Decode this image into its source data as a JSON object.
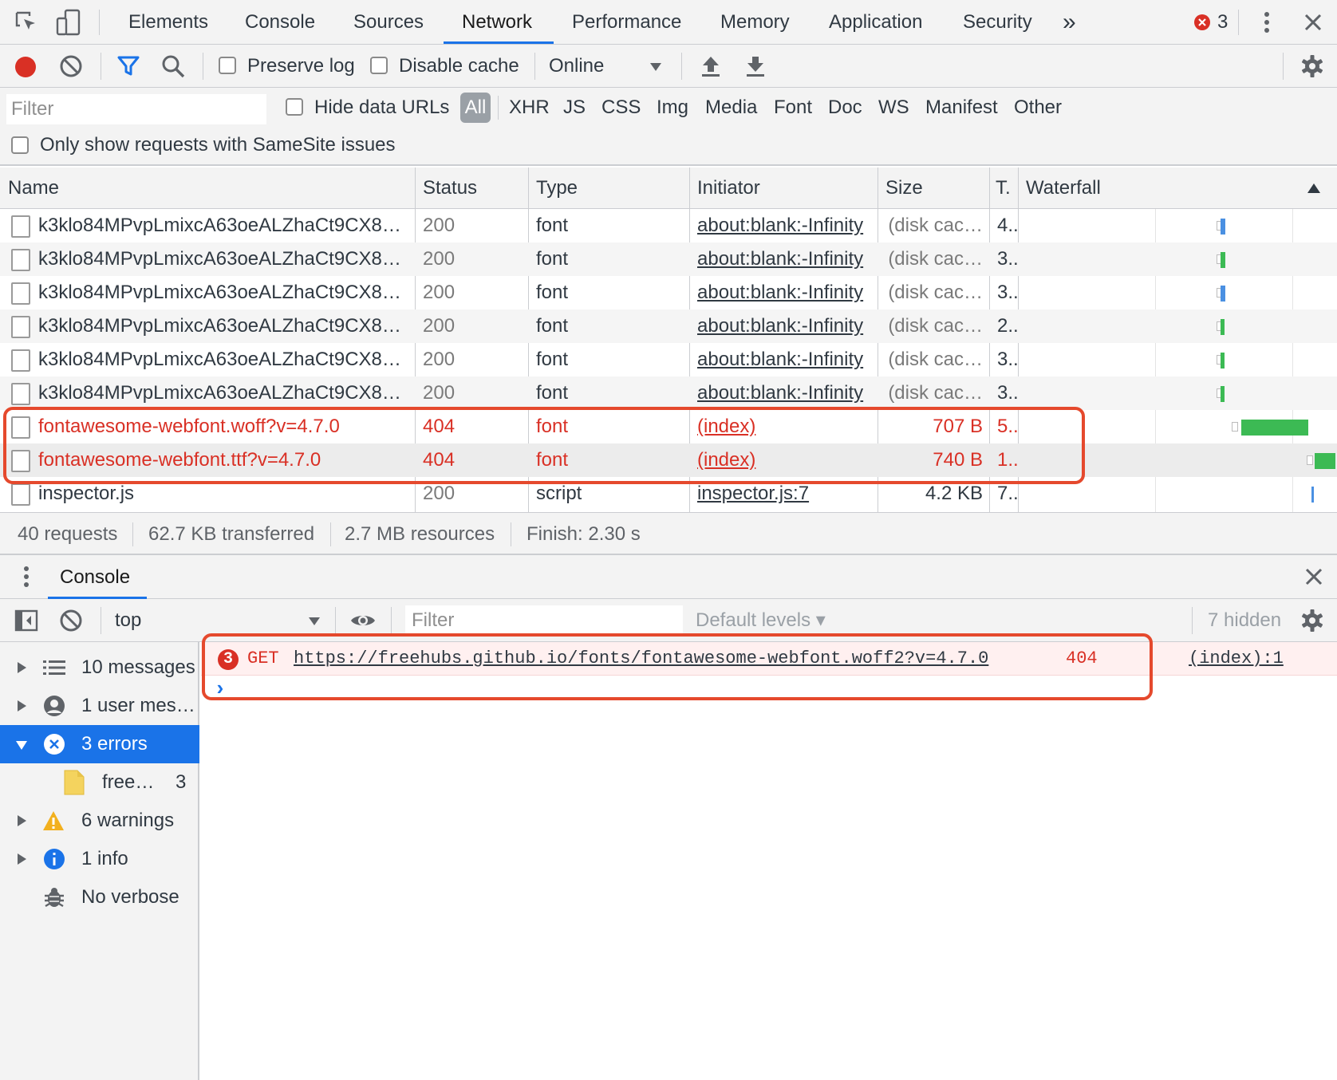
{
  "tabbar": {
    "tabs": [
      "Elements",
      "Console",
      "Sources",
      "Network",
      "Performance",
      "Memory",
      "Application",
      "Security"
    ],
    "active_tab": "Network",
    "more_label": "»",
    "error_count": "3"
  },
  "toolbar": {
    "preserve_log": "Preserve log",
    "disable_cache": "Disable cache",
    "throttling": "Online"
  },
  "filterbar": {
    "filter_placeholder": "Filter",
    "hide_data_urls": "Hide data URLs",
    "types": [
      "All",
      "XHR",
      "JS",
      "CSS",
      "Img",
      "Media",
      "Font",
      "Doc",
      "WS",
      "Manifest",
      "Other"
    ],
    "active_type": "All",
    "samesite": "Only show requests with SameSite issues"
  },
  "table": {
    "columns": {
      "name": "Name",
      "status": "Status",
      "type": "Type",
      "initiator": "Initiator",
      "size": "Size",
      "time": "T.",
      "waterfall": "Waterfall"
    },
    "rows": [
      {
        "name": "k3klo84MPvpLmixcA63oeALZhaCt9CX8…",
        "status": "200",
        "type": "font",
        "initiator": "about:blank:-Infinity",
        "size": "(disk cac…",
        "time": "4..",
        "error": false
      },
      {
        "name": "k3klo84MPvpLmixcA63oeALZhaCt9CX8…",
        "status": "200",
        "type": "font",
        "initiator": "about:blank:-Infinity",
        "size": "(disk cac…",
        "time": "3..",
        "error": false
      },
      {
        "name": "k3klo84MPvpLmixcA63oeALZhaCt9CX8…",
        "status": "200",
        "type": "font",
        "initiator": "about:blank:-Infinity",
        "size": "(disk cac…",
        "time": "3..",
        "error": false
      },
      {
        "name": "k3klo84MPvpLmixcA63oeALZhaCt9CX8…",
        "status": "200",
        "type": "font",
        "initiator": "about:blank:-Infinity",
        "size": "(disk cac…",
        "time": "2..",
        "error": false
      },
      {
        "name": "k3klo84MPvpLmixcA63oeALZhaCt9CX8…",
        "status": "200",
        "type": "font",
        "initiator": "about:blank:-Infinity",
        "size": "(disk cac…",
        "time": "3..",
        "error": false
      },
      {
        "name": "k3klo84MPvpLmixcA63oeALZhaCt9CX8…",
        "status": "200",
        "type": "font",
        "initiator": "about:blank:-Infinity",
        "size": "(disk cac…",
        "time": "3..",
        "error": false
      },
      {
        "name": "fontawesome-webfont.woff?v=4.7.0",
        "status": "404",
        "type": "font",
        "initiator": "(index)",
        "size": "707 B",
        "time": "5..",
        "error": true
      },
      {
        "name": "fontawesome-webfont.ttf?v=4.7.0",
        "status": "404",
        "type": "font",
        "initiator": "(index)",
        "size": "740 B",
        "time": "1..",
        "error": true
      },
      {
        "name": "inspector.js",
        "status": "200",
        "type": "script",
        "initiator": "inspector.js:7",
        "size": "4.2 KB",
        "time": "7..",
        "error": false
      }
    ]
  },
  "summary": {
    "requests": "40 requests",
    "transferred": "62.7 KB transferred",
    "resources": "2.7 MB resources",
    "finish": "Finish: 2.30 s"
  },
  "drawer": {
    "tab": "Console"
  },
  "console": {
    "context": "top",
    "filter_placeholder": "Filter",
    "levels": "Default levels ▾",
    "hidden": "7 hidden",
    "sidebar": [
      {
        "label": "10 messages",
        "icon": "list-icon"
      },
      {
        "label": "1 user mes…",
        "icon": "user-icon"
      },
      {
        "label": "3 errors",
        "icon": "error-icon"
      },
      {
        "label": "free…",
        "icon": "file-icon",
        "count": "3"
      },
      {
        "label": "6 warnings",
        "icon": "warning-icon"
      },
      {
        "label": "1 info",
        "icon": "info-icon"
      },
      {
        "label": "No verbose",
        "icon": "bug-icon"
      }
    ],
    "message": {
      "count": "3",
      "method": "GET",
      "url": "https://freehubs.github.io/fonts/fontawesome-webfont.woff2?v=4.7.0",
      "status": "404",
      "source": "(index):1"
    },
    "prompt": "›"
  },
  "colors": {
    "accent": "#1a73e8",
    "error": "#d93025",
    "highlight": "#e5492d"
  }
}
